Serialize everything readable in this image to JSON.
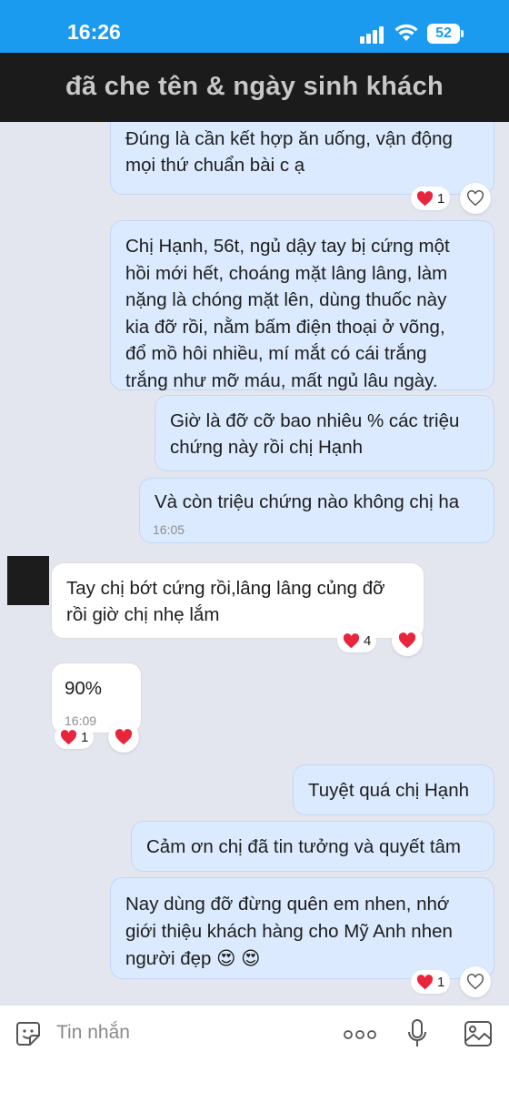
{
  "status_bar": {
    "time": "16:26",
    "battery": "52"
  },
  "banner": {
    "text": "đã che tên & ngày sinh khách"
  },
  "messages": [
    {
      "lines": [
        "Đúng là cần kết hợp ăn uống, vận động",
        "mọi thứ chuẩn bài c ạ"
      ],
      "reaction_count": "1"
    },
    {
      "lines": [
        "Chị Hạnh, 56t, ngủ dậy tay bị cứng một",
        "hồi mới hết, choáng mặt lâng lâng, làm",
        "nặng là chóng mặt lên, dùng thuốc này",
        "kia đỡ rồi, nằm bấm điện thoại ở võng,",
        "đổ mồ hôi nhiều,  mí mắt có cái trắng",
        "trắng như mỡ máu, mất ngủ lâu ngày."
      ]
    },
    {
      "lines": [
        "Giờ là đỡ cỡ bao nhiêu % các triệu",
        "chứng này rồi chị Hạnh"
      ]
    },
    {
      "lines": [
        "Và còn triệu chứng nào không chị ha"
      ],
      "time": "16:05"
    },
    {
      "lines": [
        "Tay chị bớt cứng rồi,lâng lâng củng đỡ",
        "rồi giờ chị nhẹ lắm"
      ],
      "reaction_count": "4"
    },
    {
      "lines": [
        "90%"
      ],
      "time": "16:09",
      "reaction_count": "1"
    },
    {
      "lines": [
        "Tuyệt quá chị Hạnh"
      ]
    },
    {
      "lines": [
        "Cảm ơn chị đã tin tưởng và quyết tâm"
      ]
    },
    {
      "lines": [
        "Nay dùng đỡ đừng quên em nhen, nhớ",
        "giới thiệu khách hàng cho Mỹ Anh nhen",
        "người đẹp 😍 😍"
      ],
      "reaction_count": "1"
    }
  ],
  "input": {
    "placeholder": "Tin nhắn"
  },
  "colors": {
    "status_bar": "#1a9bf0",
    "banner_bg": "#1b1b1b",
    "my_bubble": "#dbeafe",
    "heart": "#e8253d"
  }
}
